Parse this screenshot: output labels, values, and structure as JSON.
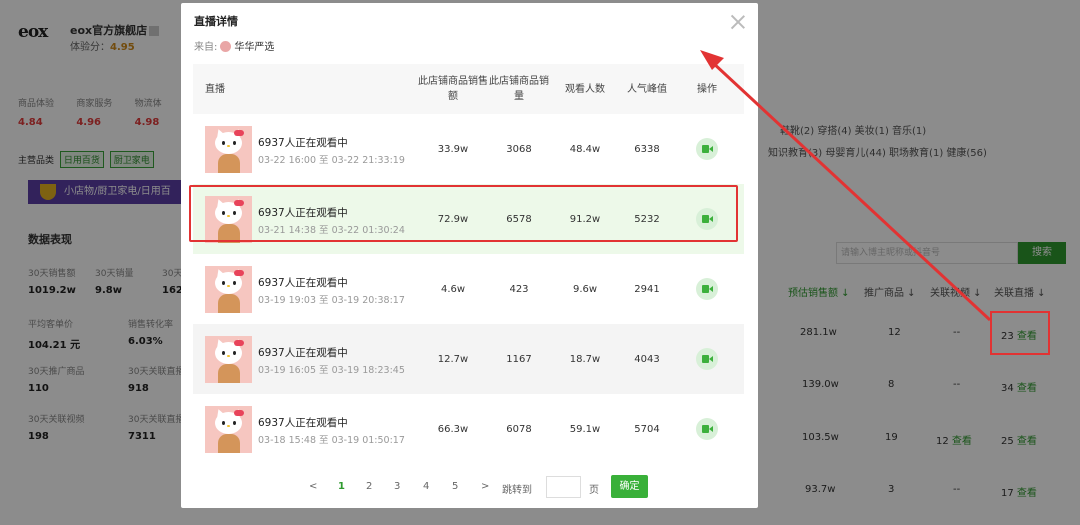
{
  "background": {
    "logo": "eox",
    "shop_name": "eox官方旗舰店",
    "exp_label": "体验分：",
    "exp_value": "4.95",
    "metrics": [
      {
        "label": "商品体验",
        "value": "4.84"
      },
      {
        "label": "商家服务",
        "value": "4.96"
      },
      {
        "label": "物流体",
        "value": "4.98"
      }
    ],
    "main_category_label": "主营品类",
    "category_tags": [
      "日用百货",
      "厨卫家电"
    ],
    "promo_text": "小店物/厨卫家电/日用百",
    "data_section_title": "数据表现",
    "stats": [
      {
        "label": "30天销售额",
        "value": "1019.2w"
      },
      {
        "label": "30天销量",
        "value": "9.8w"
      },
      {
        "label": "30天",
        "value": "162."
      },
      {
        "label": "平均客单价",
        "value": "104.21 元"
      },
      {
        "label": "销售转化率",
        "value": "6.03%"
      },
      {
        "label": "30天推广商品",
        "value": "110"
      },
      {
        "label": "30天关联直播",
        "value": "918"
      },
      {
        "label": "30天关联视频",
        "value": "198"
      },
      {
        "label": "30天关联直播",
        "value": "7311"
      }
    ],
    "right_categories_line1": "鞋靴(2)    穿搭(4)    美妆(1)    音乐(1)",
    "right_categories_line2": "知识教育(3)  母婴育儿(44)  职场教育(1)  健康(56)",
    "search_placeholder": "请输入博主昵称或抖音号",
    "search_button": "搜索",
    "columns": [
      "预估销售额 ↓",
      "推广商品 ↓",
      "关联视频 ↓",
      "关联直播 ↓"
    ],
    "rows": [
      {
        "sales": "281.1w",
        "goods": "12",
        "videos": "--",
        "lives": "23",
        "view": "查看"
      },
      {
        "sales": "139.0w",
        "goods": "8",
        "videos": "--",
        "lives": "34",
        "view": "查看"
      },
      {
        "sales": "103.5w",
        "goods": "19",
        "videos": "12",
        "lives": "25",
        "view": "查看"
      },
      {
        "sales": "93.7w",
        "goods": "3",
        "videos": "--",
        "lives": "17",
        "view": "查看"
      }
    ]
  },
  "modal": {
    "title": "直播详情",
    "source_label": "来自:",
    "source_name": "华华严选",
    "headers": {
      "live": "直播",
      "sales": "此店铺商品销售额",
      "volume": "此店铺商品销量",
      "viewers": "观看人数",
      "peak": "人气峰值",
      "op": "操作"
    },
    "rows": [
      {
        "title": "6937人正在观看中",
        "start": "03-22 16:00",
        "to": "至",
        "end": "03-22 21:33:19",
        "sales": "33.9w",
        "volume": "3068",
        "viewers": "48.4w",
        "peak": "6338"
      },
      {
        "title": "6937人正在观看中",
        "start": "03-21 14:38",
        "to": "至",
        "end": "03-22 01:30:24",
        "sales": "72.9w",
        "volume": "6578",
        "viewers": "91.2w",
        "peak": "5232"
      },
      {
        "title": "6937人正在观看中",
        "start": "03-19 19:03",
        "to": "至",
        "end": "03-19 20:38:17",
        "sales": "4.6w",
        "volume": "423",
        "viewers": "9.6w",
        "peak": "2941"
      },
      {
        "title": "6937人正在观看中",
        "start": "03-19 16:05",
        "to": "至",
        "end": "03-19 18:23:45",
        "sales": "12.7w",
        "volume": "1167",
        "viewers": "18.7w",
        "peak": "4043"
      },
      {
        "title": "6937人正在观看中",
        "start": "03-18 15:48",
        "to": "至",
        "end": "03-19 01:50:17",
        "sales": "66.3w",
        "volume": "6078",
        "viewers": "59.1w",
        "peak": "5704"
      }
    ],
    "pagination": {
      "prev": "<",
      "pages": [
        "1",
        "2",
        "3",
        "4",
        "5"
      ],
      "current": "1",
      "next": ">",
      "jump_label": "跳转到",
      "page_unit": "页",
      "confirm": "确定"
    }
  }
}
